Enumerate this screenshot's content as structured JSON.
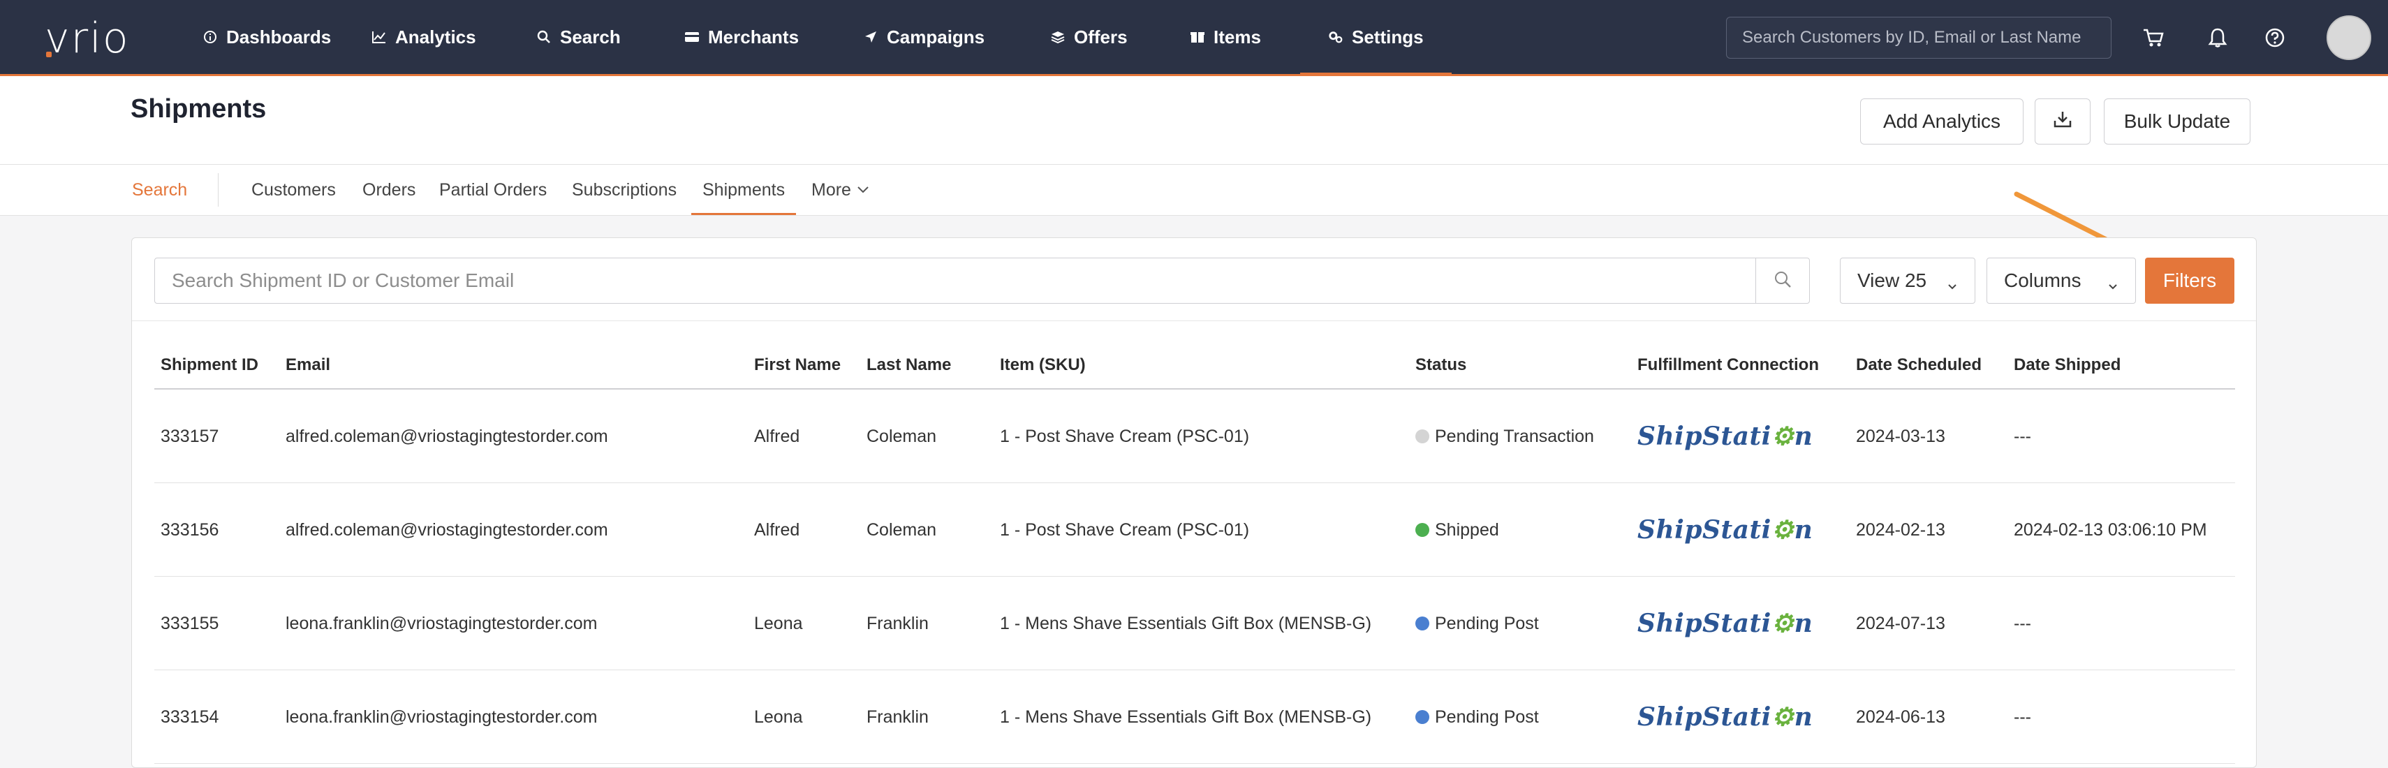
{
  "brand": {
    "logo_text": "vrio",
    "accent": "#e4763a",
    "nav_bg": "#2b3245"
  },
  "nav": {
    "items": [
      {
        "label": "Dashboards",
        "icon": "info-circle-icon"
      },
      {
        "label": "Analytics",
        "icon": "line-chart-icon"
      },
      {
        "label": "Search",
        "icon": "search-icon"
      },
      {
        "label": "Merchants",
        "icon": "card-icon"
      },
      {
        "label": "Campaigns",
        "icon": "send-icon"
      },
      {
        "label": "Offers",
        "icon": "layers-icon"
      },
      {
        "label": "Items",
        "icon": "box-icon"
      },
      {
        "label": "Settings",
        "icon": "gears-icon",
        "active": true
      }
    ],
    "search_placeholder": "Search Customers by ID, Email or Last Name"
  },
  "page": {
    "title": "Shipments",
    "add_analytics": "Add Analytics",
    "bulk_update": "Bulk Update"
  },
  "subtabs": {
    "search": "Search",
    "items": [
      "Customers",
      "Orders",
      "Partial Orders",
      "Subscriptions",
      "Shipments"
    ],
    "active": "Shipments",
    "more": "More"
  },
  "toolbar": {
    "search_placeholder": "Search Shipment ID or Customer Email",
    "view": "View 25",
    "columns": "Columns",
    "filters": "Filters"
  },
  "table": {
    "headers": [
      "Shipment ID",
      "Email",
      "First Name",
      "Last Name",
      "Item (SKU)",
      "Status",
      "Fulfillment Connection",
      "Date Scheduled",
      "Date Shipped"
    ],
    "rows": [
      {
        "id": "333157",
        "email": "alfred.coleman@vriostagingtestorder.com",
        "first": "Alfred",
        "last": "Coleman",
        "item": "1 - Post Shave Cream (PSC-01)",
        "status": "Pending Transaction",
        "status_color": "#d4d4d4",
        "connection": "ShipStation",
        "scheduled": "2024-03-13",
        "shipped": "---"
      },
      {
        "id": "333156",
        "email": "alfred.coleman@vriostagingtestorder.com",
        "first": "Alfred",
        "last": "Coleman",
        "item": "1 - Post Shave Cream (PSC-01)",
        "status": "Shipped",
        "status_color": "#4caf50",
        "connection": "ShipStation",
        "scheduled": "2024-02-13",
        "shipped": "2024-02-13 03:06:10 PM"
      },
      {
        "id": "333155",
        "email": "leona.franklin@vriostagingtestorder.com",
        "first": "Leona",
        "last": "Franklin",
        "item": "1 - Mens Shave Essentials Gift Box (MENSB-G)",
        "status": "Pending Post",
        "status_color": "#4a7fd0",
        "connection": "ShipStation",
        "scheduled": "2024-07-13",
        "shipped": "---"
      },
      {
        "id": "333154",
        "email": "leona.franklin@vriostagingtestorder.com",
        "first": "Leona",
        "last": "Franklin",
        "item": "1 - Mens Shave Essentials Gift Box (MENSB-G)",
        "status": "Pending Post",
        "status_color": "#4a7fd0",
        "connection": "ShipStation",
        "scheduled": "2024-06-13",
        "shipped": "---"
      }
    ]
  }
}
